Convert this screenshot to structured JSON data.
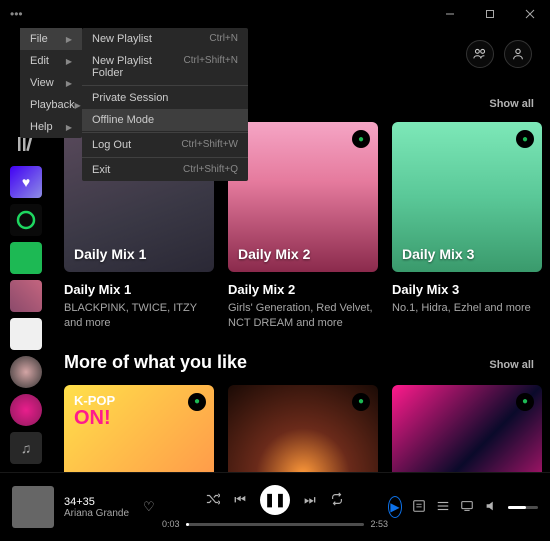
{
  "titlebar": {
    "dots": "•••"
  },
  "menubar": {
    "items": [
      {
        "label": "File"
      },
      {
        "label": "Edit"
      },
      {
        "label": "View"
      },
      {
        "label": "Playback"
      },
      {
        "label": "Help"
      }
    ]
  },
  "submenu": {
    "items": [
      {
        "label": "New Playlist",
        "shortcut": "Ctrl+N"
      },
      {
        "label": "New Playlist Folder",
        "shortcut": "Ctrl+Shift+N"
      },
      {
        "label": "Private Session",
        "shortcut": ""
      },
      {
        "label": "Offline Mode",
        "shortcut": ""
      },
      {
        "label": "Log Out",
        "shortcut": "Ctrl+Shift+W"
      },
      {
        "label": "Exit",
        "shortcut": "Ctrl+Shift+Q"
      }
    ]
  },
  "sections": {
    "made_for_you": {
      "show_all": "Show all"
    },
    "more_of": {
      "title": "More of what you like",
      "show_all": "Show all"
    }
  },
  "cards": {
    "mix1": {
      "cover_label": "Daily Mix 1",
      "title": "Daily Mix 1",
      "sub": "BLACKPINK, TWICE, ITZY and more"
    },
    "mix2": {
      "cover_label": "Daily Mix 2",
      "title": "Daily Mix 2",
      "sub": "Girls' Generation, Red Velvet, NCT DREAM and more"
    },
    "mix3": {
      "cover_label": "Daily Mix 3",
      "title": "Daily Mix 3",
      "sub": "No.1, Hidra, Ezhel and more"
    },
    "kpop": {
      "line1": "K-POP",
      "line2": "ON!"
    }
  },
  "player": {
    "track": "34+35",
    "artist": "Ariana Grande",
    "elapsed": "0:03",
    "total": "2:53"
  },
  "icons": {
    "spotify_badge": "●"
  }
}
